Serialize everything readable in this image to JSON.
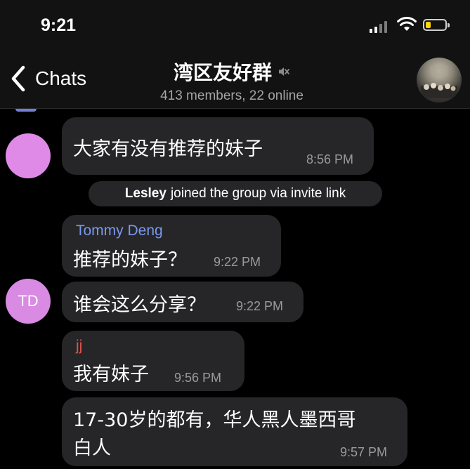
{
  "status_bar": {
    "time": "9:21",
    "signal": "signal-bars-icon",
    "wifi": "wifi-icon",
    "battery": "battery-low-icon",
    "battery_color": "#ffd60a"
  },
  "header": {
    "back_label": "Chats",
    "title": "湾区友好群",
    "muted": true,
    "subtitle": "413 members, 22 online",
    "avatar": "group-avatar-photo"
  },
  "colors": {
    "bubble": "#262628",
    "background": "#000000",
    "tommy_name": "#7a98ee",
    "jj_name": "#e05252",
    "avatar": "#e08ae8"
  },
  "messages": [
    {
      "text": "大家有没有推荐的妹子",
      "time": "8:56 PM"
    },
    {
      "service_name": "Lesley",
      "service_text": "joined the group via invite link"
    },
    {
      "sender": "Tommy Deng",
      "text": "推荐的妹子？",
      "time": "9:22 PM"
    },
    {
      "avatar_initials": "TD",
      "text": "谁会这么分享？",
      "time": "9:22 PM"
    },
    {
      "sender": "jj",
      "text": "我有妹子",
      "time": "9:56 PM"
    },
    {
      "text_line1": "17-30岁的都有，华人黑人墨西哥",
      "text_line2": "白人",
      "time": "9:57 PM"
    }
  ]
}
